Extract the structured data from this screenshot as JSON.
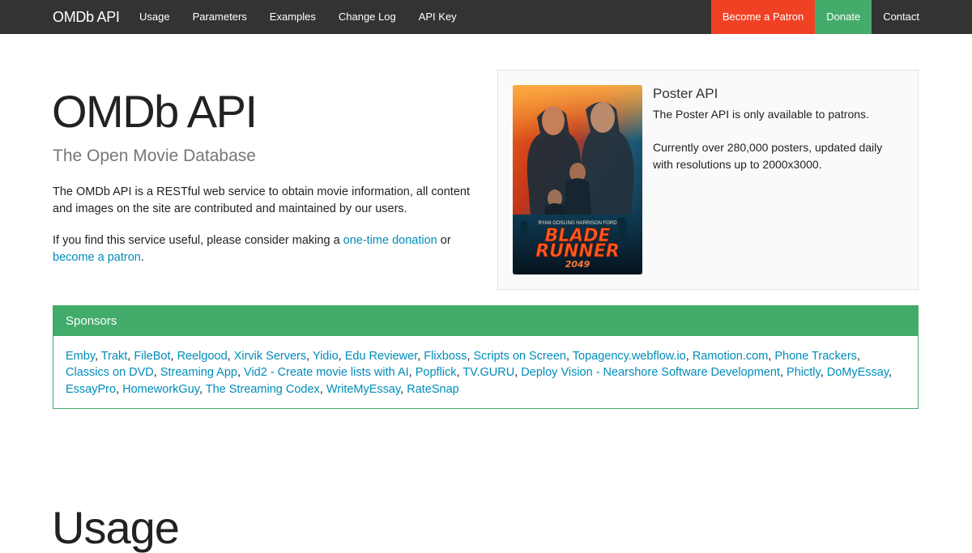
{
  "navbar": {
    "brand": "OMDb API",
    "left_items": [
      "Usage",
      "Parameters",
      "Examples",
      "Change Log",
      "API Key"
    ],
    "right_items": [
      {
        "label": "Become a Patron",
        "bg": "#f04124"
      },
      {
        "label": "Donate",
        "bg": "#43ac6a"
      },
      {
        "label": "Contact",
        "bg": "transparent"
      }
    ]
  },
  "hero": {
    "title": "OMDb API",
    "subtitle": "The Open Movie Database",
    "intro": "The OMDb API is a RESTful web service to obtain movie information, all content and images on the site are contributed and maintained by our users.",
    "support_prefix": "If you find this service useful, please consider making a ",
    "donation_link": "one-time donation",
    "support_middle": " or ",
    "patron_link": "become a patron",
    "support_suffix": "."
  },
  "poster_panel": {
    "title": "Poster API",
    "text1": "The Poster API is only available to patrons.",
    "text2": "Currently over 280,000 posters, updated daily with resolutions up to 2000x3000.",
    "poster": {
      "cast": "RYAN GOSLING   HARRISON FORD",
      "title_line1": "BLADE",
      "title_line2": "RUNNER",
      "year": "2049"
    }
  },
  "sponsors": {
    "heading": "Sponsors",
    "items": [
      "Emby",
      "Trakt",
      "FileBot",
      "Reelgood",
      "Xirvik Servers",
      "Yidio",
      "Edu Reviewer",
      "Flixboss",
      "Scripts on Screen",
      "Topagency.webflow.io",
      "Ramotion.com",
      "Phone Trackers",
      "Classics on DVD",
      "Streaming App",
      "Vid2 - Create movie lists with AI",
      "Popflick",
      "TV.GURU",
      "Deploy Vision - Nearshore Software Development",
      "Phictly",
      "DoMyEssay",
      "EssayPro",
      "HomeworkGuy",
      "The Streaming Codex",
      "WriteMyEssay",
      "RateSnap"
    ]
  },
  "usage": {
    "heading": "Usage"
  },
  "colors": {
    "navbar_bg": "#333333",
    "link": "#008cba",
    "success": "#43ac6a",
    "alert": "#f04124"
  }
}
